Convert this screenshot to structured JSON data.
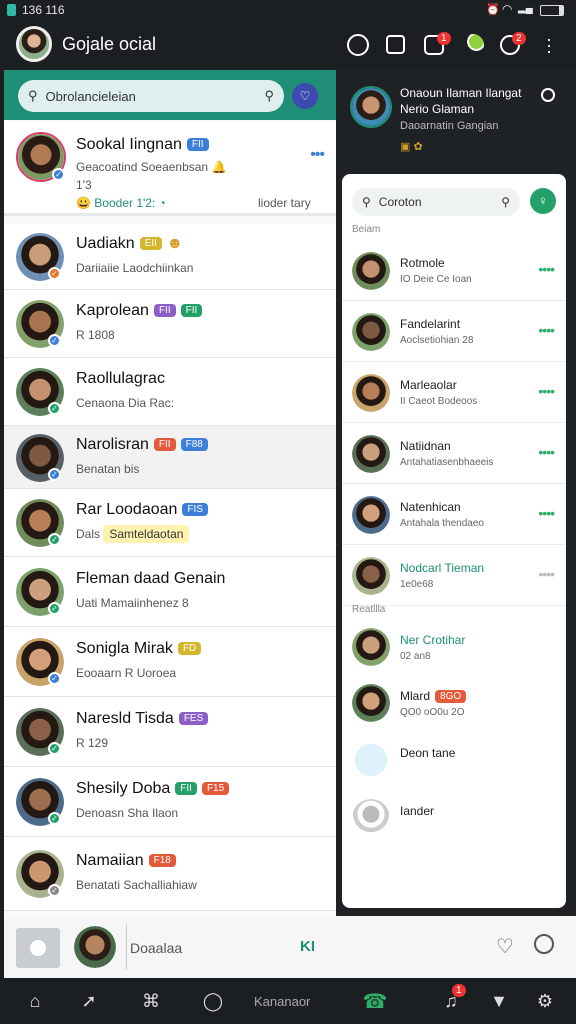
{
  "status_bar": {
    "time": "136 116"
  },
  "app_bar": {
    "title": "Gojale ocial",
    "badge_1": "1",
    "badge_2": "2"
  },
  "left_panel": {
    "search_placeholder": "Obrolancieleian",
    "pinned": {
      "name": "Sookal Iingnan",
      "name_badge": "FII",
      "line1": "Geacoatind Soeaenbsan",
      "line2": "1'3",
      "line3_left": "Booder  1'2:",
      "line3_right": "lioder tary"
    },
    "contacts": [
      {
        "name": "Uadiakn",
        "badges": [
          "EII"
        ],
        "emoji": "yes",
        "sub": "Dariiaiie Laodchiinkan"
      },
      {
        "name": "Kaprolean",
        "badges": [
          "FII",
          "FII"
        ],
        "sub": "R 1808"
      },
      {
        "name": "Raollulagrac",
        "badges": [],
        "sub": "Cenaona Dia Rac:"
      },
      {
        "name": "Narolisran",
        "badges": [
          "FII",
          "F88"
        ],
        "sub": "Benatan bis"
      },
      {
        "name": "Rar Loodaoan",
        "badges": [
          "FIS"
        ],
        "sub": "Dals",
        "sub_highlight": "Samteldaotan"
      },
      {
        "name": "Fleman daad Genain",
        "badges": [],
        "sub": "Uati  Mamaiinhenez 8"
      },
      {
        "name": "Sonigla Mirak",
        "badges": [
          "FD"
        ],
        "sub": "Eooaarn  R Uoroea"
      },
      {
        "name": "Naresld Tisda",
        "badges": [
          "FES"
        ],
        "sub": "R 129"
      },
      {
        "name": "Shesily Doba",
        "badges": [
          "FII",
          "F15"
        ],
        "sub": "Denoasn Sha Ilaon"
      },
      {
        "name": "Namaiian",
        "badges": [
          "F18"
        ],
        "sub": "Benatati Sachalliahiaw"
      }
    ]
  },
  "right_panel": {
    "header_name": "Onaoun Ilaman Ilangat",
    "header_name2": "Nerio Glaman",
    "header_sub": "Daoarnatin Gangian",
    "search_placeholder": "Coroton",
    "section_1": "Beiam",
    "items": [
      {
        "name": "Rotmole",
        "sub": "IO Deie Ce Ioan"
      },
      {
        "name": "Fandelarint",
        "sub": "Aoclsetiohian 28"
      },
      {
        "name": "Marleaolar",
        "sub": "II Caeot Bodeoos"
      },
      {
        "name": "Natiidnan",
        "sub": "Antahatiasenbhaeeis"
      },
      {
        "name": "Natenhican",
        "sub": "Antahala thendaeo"
      },
      {
        "name": "Nodcarl Tieman",
        "sub": "1e0e68"
      }
    ],
    "section_2": "Reatllla",
    "items2": [
      {
        "name": "Ner Crotihar",
        "sub": "02 an8"
      },
      {
        "name": "Mlard",
        "badge": "8GO",
        "sub": "QO0 oO0u 2O"
      },
      {
        "name": "Deon tane",
        "sub": ""
      },
      {
        "name": "Iander",
        "sub": ""
      }
    ]
  },
  "compose": {
    "placeholder": "Doaalaa",
    "send_label": "KI"
  },
  "bottom_nav": {
    "center_label": "Kananaor",
    "notif_badge": "1"
  },
  "colors": {
    "accent": "#1f8f78",
    "dark": "#1c1f22",
    "online": "#2fae6a",
    "verify": "#3b7fd8"
  }
}
